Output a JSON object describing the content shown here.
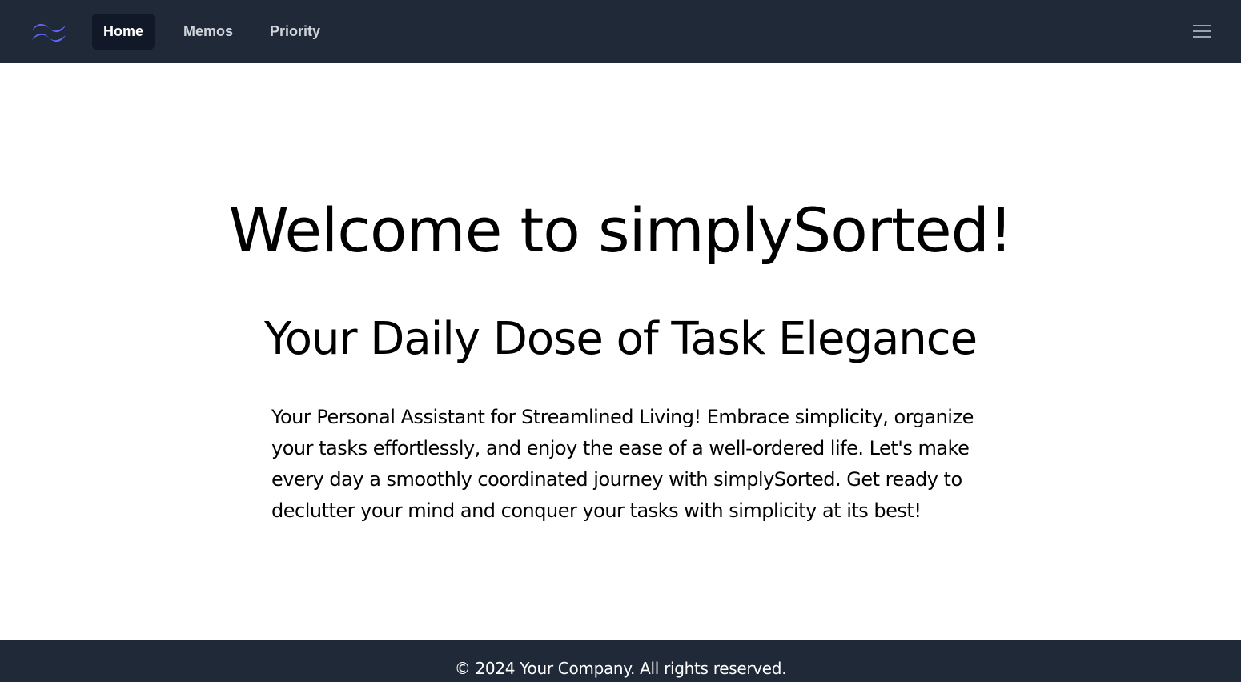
{
  "nav": {
    "logo_icon": "tailwind-wave-icon",
    "items": [
      {
        "label": "Home",
        "active": true
      },
      {
        "label": "Memos",
        "active": false
      },
      {
        "label": "Priority",
        "active": false
      }
    ],
    "menu_icon": "hamburger-menu-icon"
  },
  "hero": {
    "title": "Welcome to simplySorted!",
    "subtitle": "Your Daily Dose of Task Elegance",
    "body": "Your Personal Assistant for Streamlined Living! Embrace simplicity, organize your tasks effortlessly, and enjoy the ease of a well-ordered life. Let's make every day a smoothly coordinated journey with simplySorted. Get ready to declutter your mind and conquer your tasks with simplicity at its best!"
  },
  "footer": {
    "text": "© 2024 Your Company. All rights reserved."
  },
  "colors": {
    "nav_bg": "#1f2937",
    "nav_active_bg": "#111827",
    "logo": "#6366f1",
    "footer_bg": "#1f2937"
  }
}
